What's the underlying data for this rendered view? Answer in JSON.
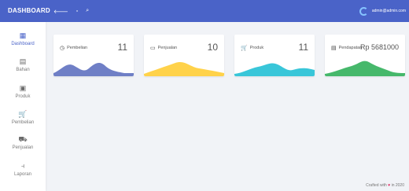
{
  "header": {
    "brand": "DASHBOARD",
    "icons": [
      "arrow-left-icon",
      "fullscreen-icon",
      "search-icon"
    ],
    "user": "admin@admin.com"
  },
  "sidebar": {
    "items": [
      {
        "label": "Dashboard",
        "icon": "dashboard-icon",
        "glyph": "▦",
        "active": true
      },
      {
        "label": "Bahan",
        "icon": "box-icon",
        "glyph": "▤"
      },
      {
        "label": "Produk",
        "icon": "product-icon",
        "glyph": "▣"
      },
      {
        "label": "Pembelian",
        "icon": "cart-icon",
        "glyph": "🛒"
      },
      {
        "label": "Penjualan",
        "icon": "basket-icon",
        "glyph": "⛟"
      },
      {
        "label": "Laporan",
        "icon": "report-icon",
        "glyph": "⫞"
      }
    ]
  },
  "cards": [
    {
      "title": "Pembelian",
      "value": "11",
      "icon": "clock-icon",
      "glyph": "◷",
      "color": "#6f7fc6"
    },
    {
      "title": "Penjualan",
      "value": "10",
      "icon": "calendar-icon",
      "glyph": "▭",
      "color": "#ffd24a"
    },
    {
      "title": "Produk",
      "value": "11",
      "icon": "cart-icon",
      "glyph": "🛒",
      "color": "#39c6d9"
    },
    {
      "title": "Pendapatan",
      "value": "Rp 5681000",
      "icon": "list-icon",
      "glyph": "▤",
      "color": "#46b86b"
    }
  ],
  "footer": {
    "text_before": "Crafted with",
    "heart": "♥",
    "text_after": "in 2020"
  },
  "colors": {
    "topbar": "#4a63c8",
    "background": "#f1f3f7",
    "accent": "#4a63c8"
  }
}
